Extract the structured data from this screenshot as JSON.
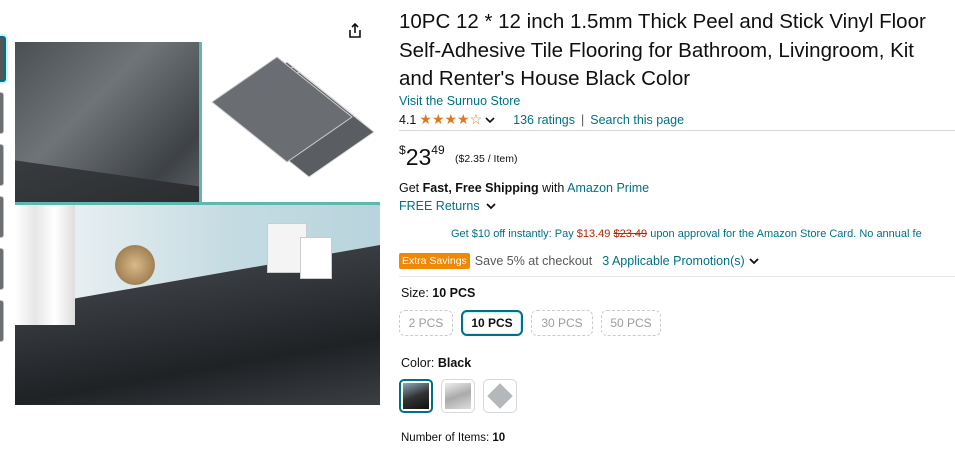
{
  "product": {
    "title_lines": [
      "10PC 12 * 12 inch 1.5mm Thick Peel and Stick Vinyl Floor",
      "Self-Adhesive Tile Flooring for Bathroom, Livingroom, Kit",
      "and Renter's House Black Color"
    ],
    "store_link": "Visit the Surnuo Store",
    "rating_value": "4.1",
    "rating_stars": "★★★★☆",
    "ratings_count": "136 ratings",
    "separator": "|",
    "search_page": "Search this page",
    "price_symbol": "$",
    "price_whole": "23",
    "price_fraction": "49",
    "unit_price": "($2.35 / Item)",
    "shipping_prefix": "Get ",
    "shipping_bold": "Fast, Free Shipping",
    "shipping_mid": " with ",
    "shipping_link": "Amazon Prime",
    "returns": "FREE Returns",
    "card_offer_1": "Get $10 off instantly: Pay ",
    "card_offer_price": "$13.49",
    "card_offer_strike": "$23.49",
    "card_offer_2": " upon approval for the Amazon Store Card. No annual fe",
    "savings_badge": "Extra Savings",
    "savings_text": "Save 5% at checkout",
    "promotions": "3 Applicable Promotion(s)",
    "size_label": "Size: ",
    "size_value": "10 PCS",
    "sizes": [
      "2 PCS",
      "10 PCS",
      "30 PCS",
      "50 PCS"
    ],
    "color_label": "Color: ",
    "color_value": "Black",
    "items_label": "Number of Items: ",
    "items_value": "10"
  },
  "icons": {
    "share": "share-icon",
    "chevron": "chevron-down-icon"
  },
  "colors": {
    "link": "#007185",
    "star": "#de7921",
    "price_red": "#b12704",
    "badge": "#f08804"
  }
}
